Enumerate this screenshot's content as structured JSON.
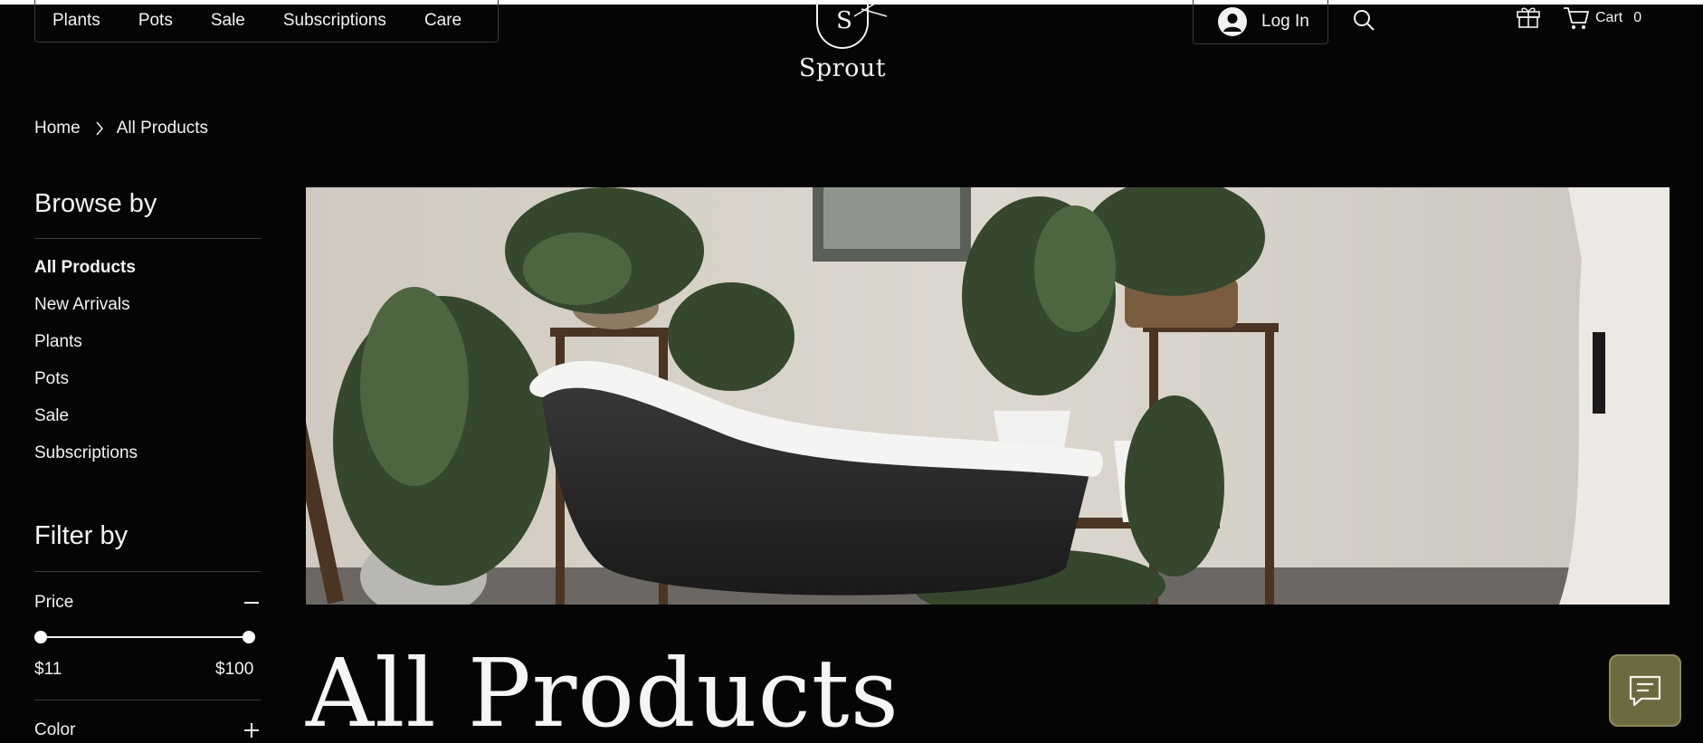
{
  "header": {
    "nav": [
      "Plants",
      "Pots",
      "Sale",
      "Subscriptions",
      "Care"
    ],
    "logo_letter": "S",
    "brand": "Sprout",
    "login_label": "Log In",
    "cart_label": "Cart",
    "cart_count": "0",
    "icons": [
      "user-avatar-icon",
      "search-icon",
      "gift-icon",
      "cart-icon"
    ]
  },
  "breadcrumb": {
    "home": "Home",
    "current": "All Products"
  },
  "sidebar": {
    "browse_title": "Browse by",
    "categories": [
      {
        "label": "All Products",
        "active": true
      },
      {
        "label": "New Arrivals",
        "active": false
      },
      {
        "label": "Plants",
        "active": false
      },
      {
        "label": "Pots",
        "active": false
      },
      {
        "label": "Sale",
        "active": false
      },
      {
        "label": "Subscriptions",
        "active": false
      }
    ],
    "filter_title": "Filter by",
    "price": {
      "label": "Price",
      "min_label": "$11",
      "max_label": "$100",
      "expanded": true
    },
    "color": {
      "label": "Color",
      "expanded": false
    }
  },
  "main": {
    "title": "All Products"
  },
  "colors": {
    "background": "#050505",
    "text": "#f2f2f2",
    "chat_button": "#6c6a3e"
  },
  "chat": {
    "icon": "chat-icon"
  }
}
